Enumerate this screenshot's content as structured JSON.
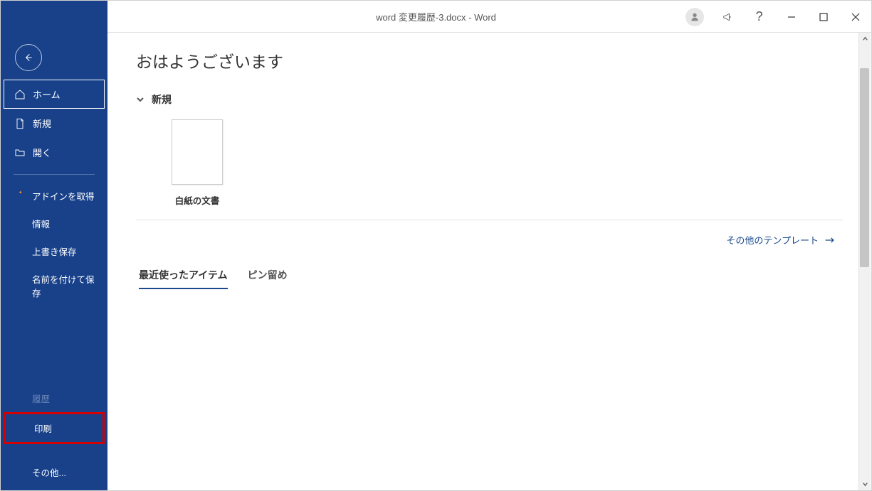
{
  "title": "word 変更履歴-3.docx  -  Word",
  "greeting": "おはようございます",
  "sidebar": {
    "home": "ホーム",
    "new": "新規",
    "open": "開く",
    "get_addins": "アドインを取得",
    "info": "情報",
    "save": "上書き保存",
    "save_as": "名前を付けて保存",
    "history": "履歴",
    "print": "印刷",
    "other": "その他..."
  },
  "section_new": "新規",
  "template_blank": "白紙の文書",
  "more_templates": "その他のテンプレート",
  "tabs": {
    "recent": "最近使ったアイテム",
    "pinned": "ピン留め"
  }
}
